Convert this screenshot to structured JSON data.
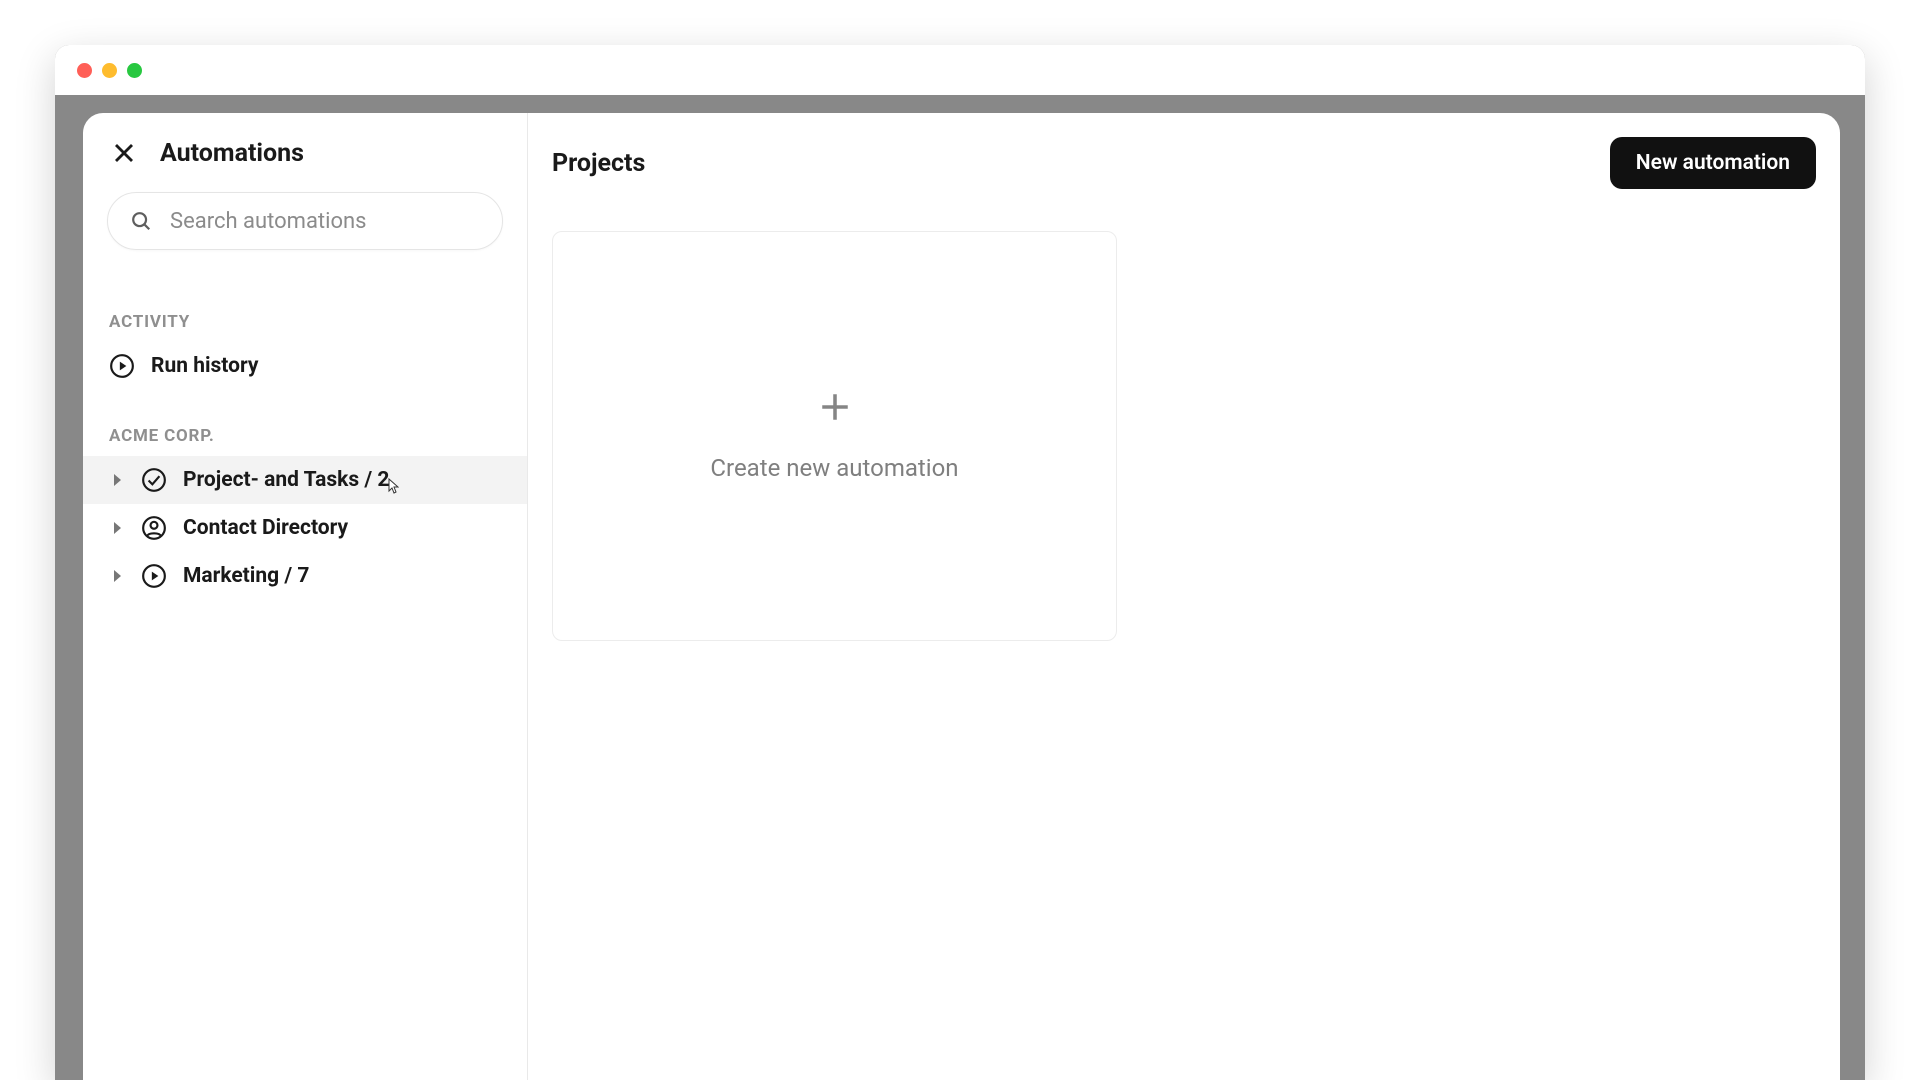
{
  "sidebar": {
    "title": "Automations",
    "search_placeholder": "Search automations",
    "sections": {
      "activity_label": "ACTIVITY",
      "run_history_label": "Run history",
      "workspace_label": "ACME CORP.",
      "items": [
        {
          "label": "Project- and Tasks / 2",
          "icon": "check"
        },
        {
          "label": "Contact Directory",
          "icon": "user"
        },
        {
          "label": "Marketing / 7",
          "icon": "play"
        }
      ]
    }
  },
  "main": {
    "title": "Projects",
    "new_button": "New automation",
    "create_card_label": "Create new automation"
  }
}
